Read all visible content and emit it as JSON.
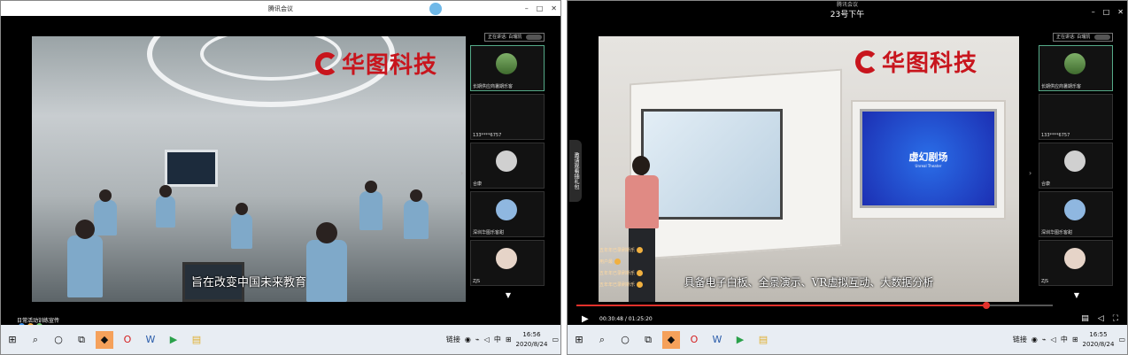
{
  "left_window": {
    "title": "腾讯会议",
    "window_controls": [
      "–",
      "□",
      "✕"
    ],
    "video_logo": "华图科技",
    "subtitle": "旨在改变中国未来教育",
    "sidebar": {
      "header_label": "正在讲话: 白瑞凯",
      "participants": [
        {
          "name": "长期供应商暑期乐客",
          "avatar": "landscape-avatar"
        },
        {
          "name": "133****6757",
          "avatar": "none"
        },
        {
          "name": "合康",
          "avatar": "vr-avatar"
        },
        {
          "name": "深圳华图乐客甜",
          "avatar": "plane-avatar"
        },
        {
          "name": "ZJS",
          "avatar": "girl-avatar"
        }
      ],
      "more_icon": "▼"
    },
    "status_text": "日常活动训练宣传"
  },
  "right_window": {
    "title_small": "腾讯会议",
    "title_main": "23号下午",
    "window_controls": [
      "–",
      "□",
      "✕"
    ],
    "video_logo": "华图科技",
    "screen_label": "虚幻剧场",
    "screen_sublabel": "Unreal Theater",
    "subtitle": "具备电子白板、全景演示、VR虚拟互动、大数据分析",
    "vertical_tab": "邀请观看抽礼包",
    "chat_lines": [
      "五年年已录刷新乐",
      "用户最",
      "五年年已录刷新乐",
      "五年年已录刷新乐"
    ],
    "sidebar": {
      "header_label": "正在讲话: 白瑞凯",
      "participants": [
        {
          "name": "长期供应商暑期乐客",
          "avatar": "landscape-avatar"
        },
        {
          "name": "133****6757",
          "avatar": "none"
        },
        {
          "name": "合康",
          "avatar": "vr-avatar"
        },
        {
          "name": "深圳华图乐客甜",
          "avatar": "plane-avatar"
        },
        {
          "name": "ZJS",
          "avatar": "girl-avatar"
        }
      ],
      "more_icon": "▼"
    },
    "time_text": "00:30:48 / 01:25:20",
    "progress": 0.86
  },
  "taskbar_left": {
    "tray_label": "链接",
    "ime": "中",
    "time": "16:56",
    "date": "2020/8/24"
  },
  "taskbar_right": {
    "tray_label": "链接",
    "ime": "中",
    "time": "16:55",
    "date": "2020/8/24"
  },
  "colors": {
    "accent_red": "#c8151d",
    "progress_red": "#e2312b",
    "taskbar": "#e8edf3"
  }
}
